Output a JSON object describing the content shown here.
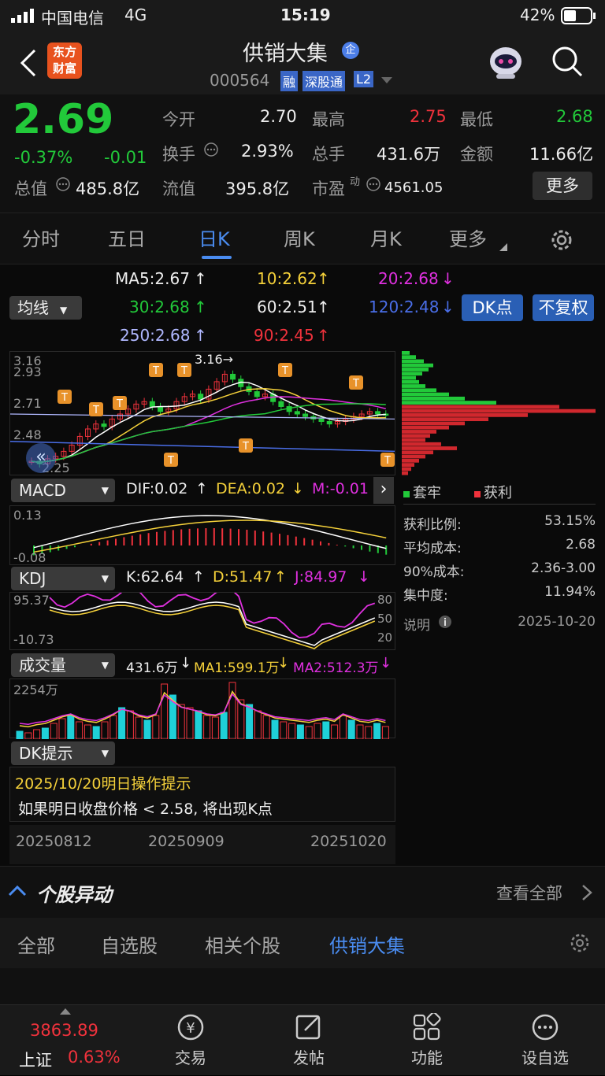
{
  "status": {
    "carrier": "中国电信",
    "network": "4G",
    "time": "15:19",
    "battery": "42%"
  },
  "header": {
    "logo_line1": "东方",
    "logo_line2": "财富",
    "stock_name": "供销大集",
    "badge": "企",
    "code": "000564",
    "tag_rong": "融",
    "tag_sgt": "深股通",
    "tag_l2": "L2"
  },
  "quote": {
    "price": "2.69",
    "pct": "-0.37%",
    "chg": "-0.01",
    "total_value_label": "总值",
    "total_value": "485.8亿",
    "open_label": "今开",
    "open": "2.70",
    "high_label": "最高",
    "high": "2.75",
    "low_label": "最低",
    "low": "2.68",
    "turnover_label": "换手",
    "turnover": "2.93%",
    "volume_label": "总手",
    "volume": "431.6万",
    "amount_label": "金额",
    "amount": "11.66亿",
    "float_label": "流值",
    "float_value": "395.8亿",
    "pe_label": "市盈",
    "pe_sup": "动",
    "pe": "4561.05",
    "more": "更多"
  },
  "tabs": [
    "分时",
    "五日",
    "日K",
    "周K",
    "月K",
    "更多"
  ],
  "active_tab": "日K",
  "ma": {
    "ma5": "MA5:2.67",
    "ma10": "10:2.62",
    "ma20": "20:2.68",
    "ma30": "30:2.68",
    "ma60": "60:2.51",
    "ma120": "120:2.48",
    "ma250": "250:2.68",
    "ma90": "90:2.45",
    "selector": "均线"
  },
  "buttons": {
    "dk": "DK点",
    "fq": "不复权"
  },
  "kline": {
    "max_price": "3.16",
    "label1": "2.93",
    "label2": "2.71",
    "label3": "2.48",
    "label4": "2.25",
    "high_mark": "3.16→"
  },
  "macd": {
    "selector": "MACD",
    "dif": "DIF:0.02",
    "dea": "DEA:0.02",
    "m": "M:-0.01",
    "top": "0.13",
    "bottom": "-0.08"
  },
  "kdj": {
    "selector": "KDJ",
    "k": "K:62.64",
    "d": "D:51.47",
    "j": "J:84.97",
    "top": "95.37",
    "bottom": "-10.73",
    "l80": "80",
    "l50": "50",
    "l20": "20"
  },
  "vol": {
    "selector": "成交量",
    "vol": "431.6万",
    "ma1": "MA1:599.1万",
    "ma2": "MA2:512.3万",
    "top": "2254万"
  },
  "dk": {
    "selector": "DK提示",
    "date_line": "2025/10/20明日操作提示",
    "msg": "如果明日收盘价格 < 2.58, 将出现K点"
  },
  "dates": [
    "20250812",
    "20250909",
    "20251020"
  ],
  "chip": {
    "legend_trap": "套牢",
    "legend_profit": "获利",
    "profit_ratio_label": "获利比例:",
    "profit_ratio": "53.15%",
    "avg_cost_label": "平均成本:",
    "avg_cost": "2.68",
    "cost90_label": "90%成本:",
    "cost90": "2.36-3.00",
    "conc_label": "集中度:",
    "conc": "11.94%",
    "note_label": "说明",
    "note_date": "2025-10-20"
  },
  "movers": {
    "title": "个股异动",
    "view_all": "查看全部"
  },
  "subtabs": [
    "全部",
    "自选股",
    "相关个股",
    "供销大集"
  ],
  "bottom": {
    "index_value": "3863.89",
    "index_name": "上证",
    "index_pct": "0.63%",
    "trade": "交易",
    "post": "发帖",
    "func": "功能",
    "watch": "设自选"
  },
  "colors": {
    "up": "#f0323c",
    "down": "#22c93a",
    "accent": "#2a5fb5",
    "yellow": "#f5d13a",
    "magenta": "#e030e0"
  }
}
